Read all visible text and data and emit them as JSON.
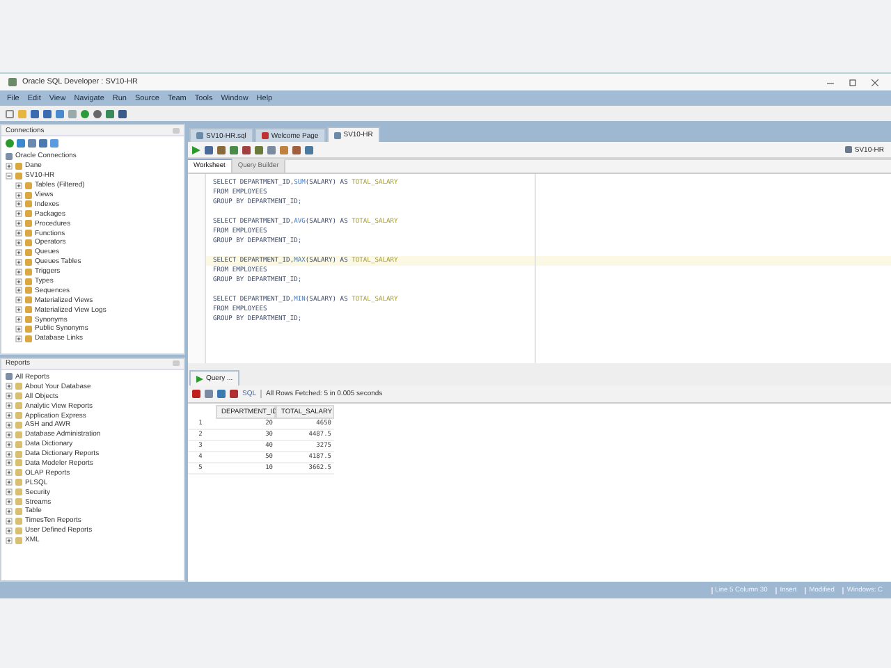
{
  "window": {
    "title": "Oracle SQL Developer : SV10-HR"
  },
  "menu": [
    "File",
    "Edit",
    "View",
    "Navigate",
    "Run",
    "Source",
    "Team",
    "Tools",
    "Window",
    "Help"
  ],
  "connections": {
    "title": "Connections",
    "tree": [
      {
        "label": "Oracle Connections",
        "children": [
          {
            "label": "Dane",
            "expanded": false
          },
          {
            "label": "SV10-HR",
            "expanded": true,
            "children": [
              {
                "label": "Tables (Filtered)",
                "expanded": false
              },
              {
                "label": "Views",
                "expanded": false
              },
              {
                "label": "Indexes",
                "expanded": false
              },
              {
                "label": "Packages",
                "expanded": false
              },
              {
                "label": "Procedures",
                "expanded": false
              },
              {
                "label": "Functions",
                "expanded": false
              },
              {
                "label": "Operators",
                "expanded": false
              },
              {
                "label": "Queues",
                "expanded": false
              },
              {
                "label": "Queues Tables",
                "expanded": false
              },
              {
                "label": "Triggers",
                "expanded": false
              },
              {
                "label": "Types",
                "expanded": false
              },
              {
                "label": "Sequences",
                "expanded": false
              },
              {
                "label": "Materialized Views",
                "expanded": false
              },
              {
                "label": "Materialized View Logs",
                "expanded": false
              },
              {
                "label": "Synonyms",
                "expanded": false
              },
              {
                "label": "Public Synonyms",
                "expanded": false
              },
              {
                "label": "Database Links",
                "expanded": false
              }
            ]
          }
        ]
      }
    ]
  },
  "reports": {
    "title": "Reports",
    "tree": [
      {
        "label": "All Reports",
        "children": [
          {
            "label": "About Your Database",
            "expanded": false
          },
          {
            "label": "All Objects",
            "expanded": false
          },
          {
            "label": "Analytic View Reports",
            "expanded": false
          },
          {
            "label": "Application Express",
            "expanded": false
          },
          {
            "label": "ASH and AWR",
            "expanded": false
          },
          {
            "label": "Database Administration",
            "expanded": false
          },
          {
            "label": "Data Dictionary",
            "expanded": false
          },
          {
            "label": "Data Dictionary Reports",
            "expanded": false
          },
          {
            "label": "Data Modeler Reports",
            "expanded": false
          },
          {
            "label": "OLAP Reports",
            "expanded": false
          },
          {
            "label": "PLSQL",
            "expanded": false
          },
          {
            "label": "Security",
            "expanded": false
          },
          {
            "label": "Streams",
            "expanded": false
          },
          {
            "label": "Table",
            "expanded": false
          },
          {
            "label": "TimesTen Reports",
            "expanded": false
          },
          {
            "label": "User Defined Reports",
            "expanded": false
          },
          {
            "label": "XML",
            "expanded": false
          }
        ]
      }
    ]
  },
  "editor_tabs": [
    {
      "label": "SV10-HR.sql",
      "selected": false
    },
    {
      "label": "Welcome Page",
      "selected": false
    },
    {
      "label": "SV10-HR",
      "selected": true
    }
  ],
  "connection_selector": "SV10-HR",
  "sub_tabs": [
    {
      "label": "Worksheet",
      "selected": true
    },
    {
      "label": "Query Builder",
      "selected": false
    }
  ],
  "statements": [
    {
      "lines": [
        {
          "current": false,
          "tokens": [
            {
              "text": "SELECT DEPARTMENT_ID,",
              "kind": "text"
            },
            {
              "text": "SUM",
              "kind": "function"
            },
            {
              "text": "(SALARY) AS ",
              "kind": "text"
            },
            {
              "text": "TOTAL_SALARY",
              "kind": "alias"
            }
          ]
        },
        {
          "current": false,
          "tokens": [
            {
              "text": "FROM EMPLOYEES",
              "kind": "text"
            }
          ]
        },
        {
          "current": false,
          "tokens": [
            {
              "text": "GROUP BY DEPARTMENT_ID;",
              "kind": "text"
            }
          ]
        }
      ]
    },
    {
      "lines": [
        {
          "current": false,
          "tokens": [
            {
              "text": "SELECT DEPARTMENT_ID,",
              "kind": "text"
            },
            {
              "text": "AVG",
              "kind": "function"
            },
            {
              "text": "(SALARY) AS ",
              "kind": "text"
            },
            {
              "text": "TOTAL_SALARY",
              "kind": "alias"
            }
          ]
        },
        {
          "current": false,
          "tokens": [
            {
              "text": "FROM EMPLOYEES",
              "kind": "text"
            }
          ]
        },
        {
          "current": false,
          "tokens": [
            {
              "text": "GROUP BY DEPARTMENT_ID;",
              "kind": "text"
            }
          ]
        }
      ]
    },
    {
      "lines": [
        {
          "current": true,
          "tokens": [
            {
              "text": "SELECT DEPARTMENT_ID,",
              "kind": "text"
            },
            {
              "text": "MAX",
              "kind": "function"
            },
            {
              "text": "(SALARY) AS ",
              "kind": "text"
            },
            {
              "text": "TOTAL_SALARY",
              "kind": "alias"
            }
          ]
        },
        {
          "current": false,
          "tokens": [
            {
              "text": "FROM EMPLOYEES",
              "kind": "text"
            }
          ]
        },
        {
          "current": false,
          "tokens": [
            {
              "text": "GROUP BY DEPARTMENT_ID;",
              "kind": "text"
            }
          ]
        }
      ]
    },
    {
      "lines": [
        {
          "current": false,
          "tokens": [
            {
              "text": "SELECT DEPARTMENT_ID,",
              "kind": "text"
            },
            {
              "text": "MIN",
              "kind": "function"
            },
            {
              "text": "(SALARY) AS ",
              "kind": "text"
            },
            {
              "text": "TOTAL_SALARY",
              "kind": "alias"
            }
          ]
        },
        {
          "current": false,
          "tokens": [
            {
              "text": "FROM EMPLOYEES",
              "kind": "text"
            }
          ]
        },
        {
          "current": false,
          "tokens": [
            {
              "text": "GROUP BY DEPARTMENT_ID;",
              "kind": "text"
            }
          ]
        }
      ]
    }
  ],
  "results": {
    "tab": "Query ...",
    "sql_link": "SQL",
    "status": "All Rows Fetched: 5 in 0.005 seconds",
    "columns": [
      "DEPARTMENT_ID",
      "TOTAL_SALARY"
    ],
    "rows": [
      {
        "num": "1",
        "cells": [
          "20",
          "4650"
        ]
      },
      {
        "num": "2",
        "cells": [
          "30",
          "4487.5"
        ]
      },
      {
        "num": "3",
        "cells": [
          "40",
          "3275"
        ]
      },
      {
        "num": "4",
        "cells": [
          "50",
          "4187.5"
        ]
      },
      {
        "num": "5",
        "cells": [
          "10",
          "3662.5"
        ]
      }
    ]
  },
  "status_bar": [
    "Line 5 Column 30",
    "Insert",
    "Modified",
    "Windows: C"
  ]
}
